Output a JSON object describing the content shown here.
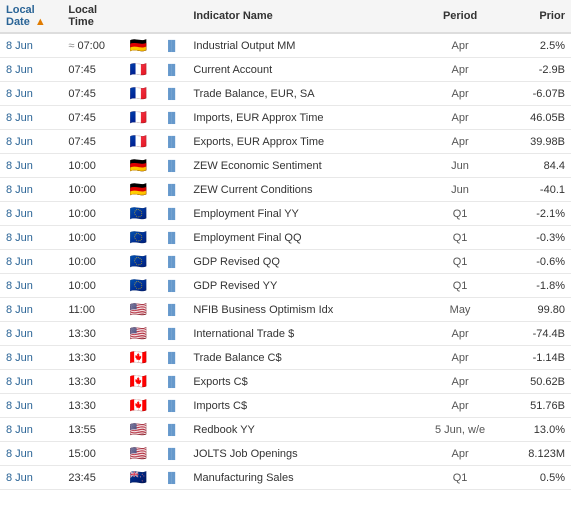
{
  "table": {
    "headers": [
      {
        "key": "local_date",
        "label": "Local Date",
        "sortable": true,
        "sorted": true,
        "sort_dir": "asc"
      },
      {
        "key": "local_time",
        "label": "Local Time",
        "sortable": false
      },
      {
        "key": "flag",
        "label": "",
        "sortable": false
      },
      {
        "key": "chart",
        "label": "",
        "sortable": false
      },
      {
        "key": "indicator_name",
        "label": "Indicator Name",
        "sortable": false
      },
      {
        "key": "period",
        "label": "Period",
        "sortable": false
      },
      {
        "key": "prior",
        "label": "Prior",
        "sortable": false
      }
    ],
    "rows": [
      {
        "date": "8 Jun",
        "time": "07:00",
        "approx": true,
        "flag": "🇩🇪",
        "name": "Industrial Output MM",
        "period": "Apr",
        "prior": "2.5%"
      },
      {
        "date": "8 Jun",
        "time": "07:45",
        "approx": false,
        "flag": "🇫🇷",
        "name": "Current Account",
        "period": "Apr",
        "prior": "-2.9B"
      },
      {
        "date": "8 Jun",
        "time": "07:45",
        "approx": false,
        "flag": "🇫🇷",
        "name": "Trade Balance, EUR, SA",
        "period": "Apr",
        "prior": "-6.07B"
      },
      {
        "date": "8 Jun",
        "time": "07:45",
        "approx": false,
        "flag": "🇫🇷",
        "name": "Imports, EUR Approx Time",
        "period": "Apr",
        "prior": "46.05B"
      },
      {
        "date": "8 Jun",
        "time": "07:45",
        "approx": false,
        "flag": "🇫🇷",
        "name": "Exports, EUR Approx Time",
        "period": "Apr",
        "prior": "39.98B"
      },
      {
        "date": "8 Jun",
        "time": "10:00",
        "approx": false,
        "flag": "🇩🇪",
        "name": "ZEW Economic Sentiment",
        "period": "Jun",
        "prior": "84.4"
      },
      {
        "date": "8 Jun",
        "time": "10:00",
        "approx": false,
        "flag": "🇩🇪",
        "name": "ZEW Current Conditions",
        "period": "Jun",
        "prior": "-40.1"
      },
      {
        "date": "8 Jun",
        "time": "10:00",
        "approx": false,
        "flag": "🇪🇺",
        "name": "Employment Final YY",
        "period": "Q1",
        "prior": "-2.1%"
      },
      {
        "date": "8 Jun",
        "time": "10:00",
        "approx": false,
        "flag": "🇪🇺",
        "name": "Employment Final QQ",
        "period": "Q1",
        "prior": "-0.3%"
      },
      {
        "date": "8 Jun",
        "time": "10:00",
        "approx": false,
        "flag": "🇪🇺",
        "name": "GDP Revised QQ",
        "period": "Q1",
        "prior": "-0.6%"
      },
      {
        "date": "8 Jun",
        "time": "10:00",
        "approx": false,
        "flag": "🇪🇺",
        "name": "GDP Revised YY",
        "period": "Q1",
        "prior": "-1.8%"
      },
      {
        "date": "8 Jun",
        "time": "11:00",
        "approx": false,
        "flag": "🇺🇸",
        "name": "NFIB Business Optimism Idx",
        "period": "May",
        "prior": "99.80"
      },
      {
        "date": "8 Jun",
        "time": "13:30",
        "approx": false,
        "flag": "🇺🇸",
        "name": "International Trade $",
        "period": "Apr",
        "prior": "-74.4B"
      },
      {
        "date": "8 Jun",
        "time": "13:30",
        "approx": false,
        "flag": "🇨🇦",
        "name": "Trade Balance C$",
        "period": "Apr",
        "prior": "-1.14B"
      },
      {
        "date": "8 Jun",
        "time": "13:30",
        "approx": false,
        "flag": "🇨🇦",
        "name": "Exports C$",
        "period": "Apr",
        "prior": "50.62B"
      },
      {
        "date": "8 Jun",
        "time": "13:30",
        "approx": false,
        "flag": "🇨🇦",
        "name": "Imports C$",
        "period": "Apr",
        "prior": "51.76B"
      },
      {
        "date": "8 Jun",
        "time": "13:55",
        "approx": false,
        "flag": "🇺🇸",
        "name": "Redbook YY",
        "period": "5 Jun, w/e",
        "prior": "13.0%"
      },
      {
        "date": "8 Jun",
        "time": "15:00",
        "approx": false,
        "flag": "🇺🇸",
        "name": "JOLTS Job Openings",
        "period": "Apr",
        "prior": "8.123M"
      },
      {
        "date": "8 Jun",
        "time": "23:45",
        "approx": false,
        "flag": "🇳🇿",
        "name": "Manufacturing Sales",
        "period": "Q1",
        "prior": "0.5%"
      }
    ]
  }
}
